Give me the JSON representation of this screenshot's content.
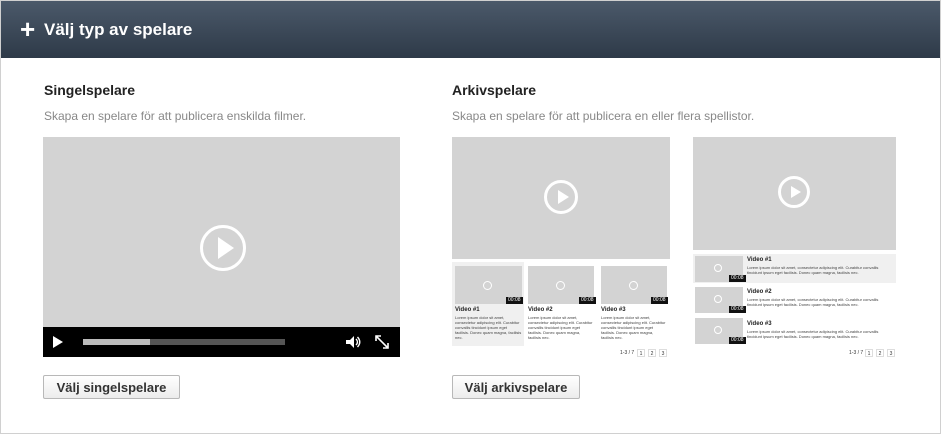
{
  "header": {
    "plus_icon": "plus-icon",
    "title": "Välj typ av spelare"
  },
  "single": {
    "title": "Singelspelare",
    "description": "Skapa en spelare för att publicera enskilda filmer.",
    "progress": 0.33,
    "button_label": "Välj singelspelare"
  },
  "archive": {
    "title": "Arkivspelare",
    "description": "Skapa en spelare för att publicera en eller flera spellistor.",
    "button_label": "Välj arkivspelare",
    "lorem": "Lorem ipsum dolor sit amet, consectetur adipiscing elit. Curabitur convallis tincidunt ipsum eget facilisis. Donec quam magna, facilisis nec.",
    "videos": [
      {
        "title": "Video #1",
        "time": "00:08"
      },
      {
        "title": "Video #2",
        "time": "00:08"
      },
      {
        "title": "Video #3",
        "time": "00:08"
      }
    ],
    "pager": {
      "range": "1-3 / 7",
      "pages": [
        "1",
        "2",
        "3"
      ]
    }
  },
  "colors": {
    "header_top": "#4b596a",
    "header_bottom": "#2e3a48",
    "placeholder": "#d3d3d3"
  }
}
